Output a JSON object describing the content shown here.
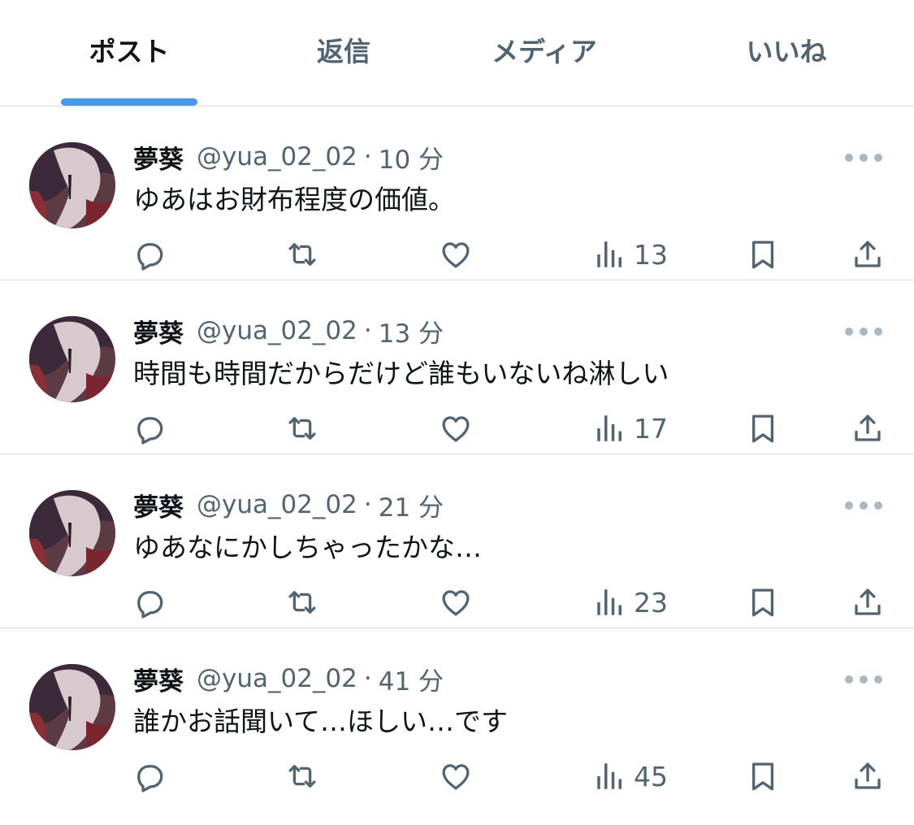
{
  "tabs": [
    {
      "label": "ポスト",
      "active": true
    },
    {
      "label": "返信",
      "active": false
    },
    {
      "label": "メディア",
      "active": false
    },
    {
      "label": "いいね",
      "active": false
    }
  ],
  "posts": [
    {
      "display_name": "夢葵",
      "handle": "@yua_02_02",
      "separator": "·",
      "time": "10 分",
      "text": "ゆあはお財布程度の価値。",
      "views": "13"
    },
    {
      "display_name": "夢葵",
      "handle": "@yua_02_02",
      "separator": "·",
      "time": "13 分",
      "text": "時間も時間だからだけど誰もいないね淋しい",
      "views": "17"
    },
    {
      "display_name": "夢葵",
      "handle": "@yua_02_02",
      "separator": "·",
      "time": "21 分",
      "text": "ゆあなにかしちゃったかな…",
      "views": "23"
    },
    {
      "display_name": "夢葵",
      "handle": "@yua_02_02",
      "separator": "·",
      "time": "41 分",
      "text": "誰かお話聞いて…ほしい…です",
      "views": "45"
    }
  ],
  "icons": {
    "reply": "speech-bubble-icon",
    "repost": "repost-arrows-icon",
    "like": "heart-icon",
    "views": "bar-chart-icon",
    "bookmark": "bookmark-icon",
    "share": "share-upload-icon",
    "more": "more-dots-icon"
  },
  "colors": {
    "accent": "#4a99e9",
    "text_primary": "#0f1419",
    "text_secondary": "#536471",
    "divider": "#d6dadd",
    "more_dots": "#aab8c2"
  }
}
